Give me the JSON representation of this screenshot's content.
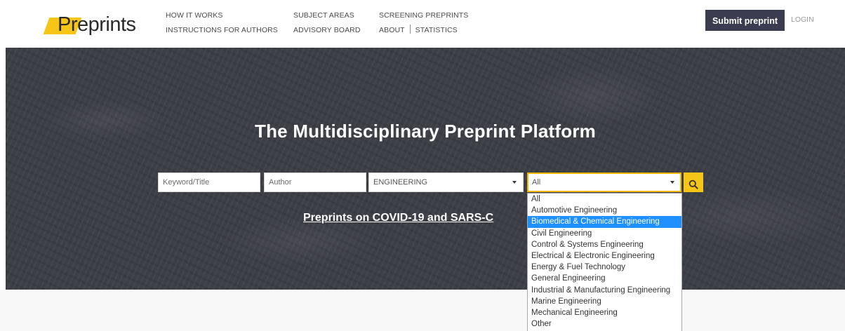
{
  "brand": {
    "logo_highlight": "Pre",
    "logo_rest": "prints",
    "accent_color": "#f5c518",
    "dark_color": "#3a3d4f"
  },
  "nav": {
    "col1": [
      "HOW IT WORKS",
      "INSTRUCTIONS FOR AUTHORS"
    ],
    "col2": [
      "SUBJECT AREAS",
      "ADVISORY BOARD"
    ],
    "col3_top": "SCREENING PREPRINTS",
    "col3_about": "ABOUT",
    "col3_statistics": "STATISTICS"
  },
  "header": {
    "submit_label": "Submit preprint",
    "login_label": "LOGIN"
  },
  "hero": {
    "title": "The Multidisciplinary Preprint Platform",
    "covid_link": "Preprints on COVID-19 and SARS-C"
  },
  "search": {
    "keyword_placeholder": "Keyword/Title",
    "author_placeholder": "Author",
    "subject_value": "ENGINEERING",
    "subarea_value": "All",
    "search_icon": "search-icon"
  },
  "dropdown": {
    "items": [
      "All",
      "Automotive Engineering",
      "Biomedical & Chemical Engineering",
      "Civil Engineering",
      "Control & Systems Engineering",
      "Electrical & Electronic Engineering",
      "Energy & Fuel Technology",
      "General Engineering",
      "Industrial & Manufacturing Engineering",
      "Marine Engineering",
      "Mechanical Engineering",
      "Other"
    ],
    "highlighted_index": 2,
    "highlight_color": "#1e90ff"
  }
}
